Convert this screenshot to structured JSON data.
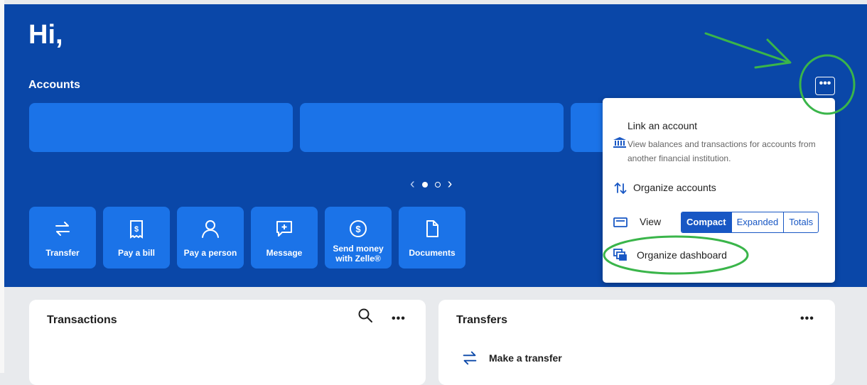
{
  "header": {
    "greeting": "Hi,",
    "accounts_label": "Accounts"
  },
  "carousel": {
    "prev": "‹",
    "next": "›",
    "active_page": 1,
    "pages": 2
  },
  "quick_actions": [
    {
      "label": "Transfer",
      "icon": "transfer-icon"
    },
    {
      "label": "Pay a bill",
      "icon": "bill-icon"
    },
    {
      "label": "Pay a person",
      "icon": "person-icon"
    },
    {
      "label": "Message",
      "icon": "message-icon"
    },
    {
      "label": "Send money\nwith Zelle®",
      "icon": "zelle-dollar-icon"
    },
    {
      "label": "Documents",
      "icon": "document-icon"
    }
  ],
  "menu": {
    "link_account": {
      "title": "Link an account",
      "description": "View balances and transactions for accounts from another financial institution.",
      "icon": "bank-icon"
    },
    "organize_accounts": {
      "title": "Organize accounts",
      "icon": "sort-arrows-icon"
    },
    "view": {
      "label": "View",
      "icon": "view-card-icon",
      "options": [
        "Compact",
        "Expanded",
        "Totals"
      ],
      "selected": "Compact"
    },
    "organize_dashboard": {
      "title": "Organize dashboard",
      "icon": "dashboard-layers-icon"
    }
  },
  "more_glyph": "•••",
  "panels": {
    "transactions": {
      "title": "Transactions",
      "search_icon": "search-icon"
    },
    "transfers": {
      "title": "Transfers",
      "make_transfer": "Make a transfer"
    }
  },
  "colors": {
    "header": "#0a47a8",
    "tile": "#1b73e8",
    "accent": "#1857c4",
    "annotation": "#3ab54a"
  }
}
